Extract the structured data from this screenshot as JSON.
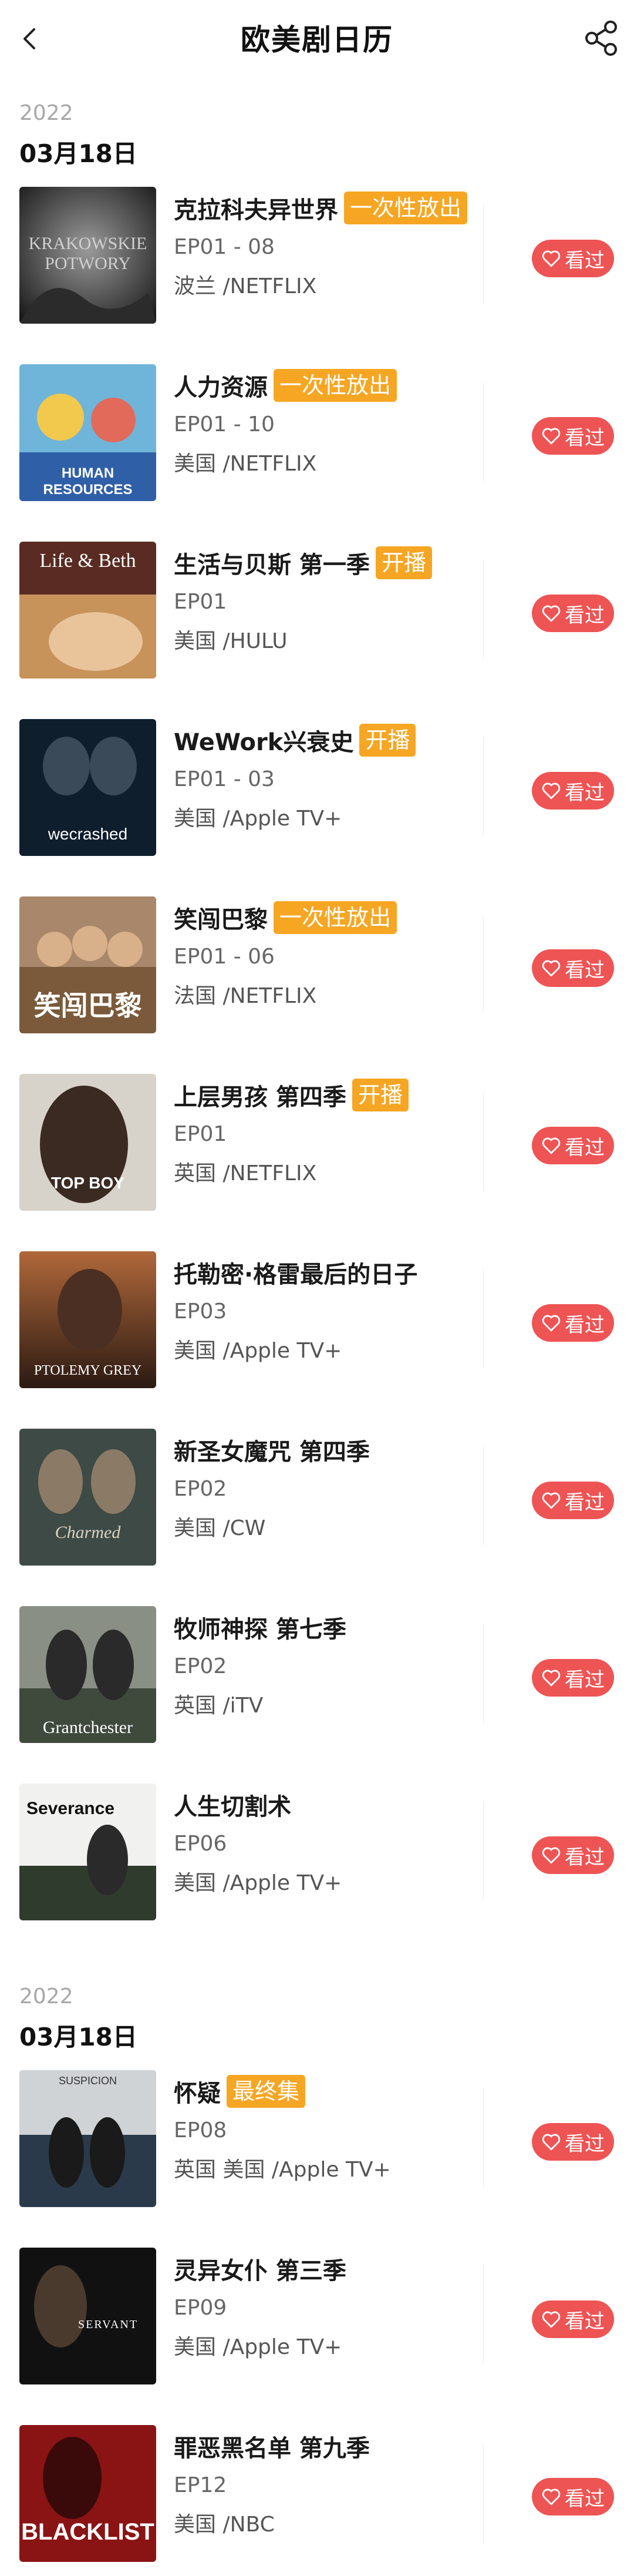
{
  "header": {
    "title": "欧美剧日历",
    "back_icon": "back-arrow-icon",
    "share_icon": "share-icon"
  },
  "colors": {
    "tag_bg": "#f6a623",
    "watched_bg": "#ee5454",
    "year_text": "#a8a8a8"
  },
  "sections": [
    {
      "year": "2022",
      "date": "03月18日",
      "items": [
        {
          "title": "克拉科夫异世界",
          "tag": "一次性放出",
          "episode": "EP01 - 08",
          "network": "波兰 /NETFLIX",
          "button": "看过",
          "poster_text": "KRAKOWSKIE POTWORY"
        },
        {
          "title": "人力资源",
          "tag": "一次性放出",
          "episode": "EP01 - 10",
          "network": "美国 /NETFLIX",
          "button": "看过",
          "poster_text": "HUMAN RESOURCES"
        },
        {
          "title": "生活与贝斯 第一季",
          "tag": "开播",
          "episode": "EP01",
          "network": "美国 /HULU",
          "button": "看过",
          "poster_text": "Life & Beth"
        },
        {
          "title": "WeWork兴衰史",
          "tag": "开播",
          "episode": "EP01 - 03",
          "network": "美国 /Apple TV+",
          "button": "看过",
          "poster_text": "wecrashed"
        },
        {
          "title": "笑闯巴黎",
          "tag": "一次性放出",
          "episode": "EP01 - 06",
          "network": "法国 /NETFLIX",
          "button": "看过",
          "poster_text": "笑闯巴黎"
        },
        {
          "title": "上层男孩 第四季",
          "tag": "开播",
          "episode": "EP01",
          "network": "英国 /NETFLIX",
          "button": "看过",
          "poster_text": "TOP BOY"
        },
        {
          "title": "托勒密·格雷最后的日子",
          "tag": "",
          "episode": "EP03",
          "network": "美国 /Apple TV+",
          "button": "看过",
          "poster_text": "PTOLEMY GREY"
        },
        {
          "title": "新圣女魔咒 第四季",
          "tag": "",
          "episode": "EP02",
          "network": "美国 /CW",
          "button": "看过",
          "poster_text": "Charmed"
        },
        {
          "title": "牧师神探 第七季",
          "tag": "",
          "episode": "EP02",
          "network": "英国 /iTV",
          "button": "看过",
          "poster_text": "Grantchester"
        },
        {
          "title": "人生切割术",
          "tag": "",
          "episode": "EP06",
          "network": "美国 /Apple TV+",
          "button": "看过",
          "poster_text": "Severance"
        }
      ]
    },
    {
      "year": "2022",
      "date": "03月18日",
      "items": [
        {
          "title": "怀疑",
          "tag": "最终集",
          "episode": "EP08",
          "network": "英国 美国 /Apple TV+",
          "button": "看过",
          "poster_text": "SUSPICION"
        },
        {
          "title": "灵异女仆 第三季",
          "tag": "",
          "episode": "EP09",
          "network": "美国 /Apple TV+",
          "button": "看过",
          "poster_text": "SERVANT"
        },
        {
          "title": "罪恶黑名单 第九季",
          "tag": "",
          "episode": "EP12",
          "network": "美国 /NBC",
          "button": "看过",
          "poster_text": "BLACKLIST"
        }
      ]
    }
  ]
}
